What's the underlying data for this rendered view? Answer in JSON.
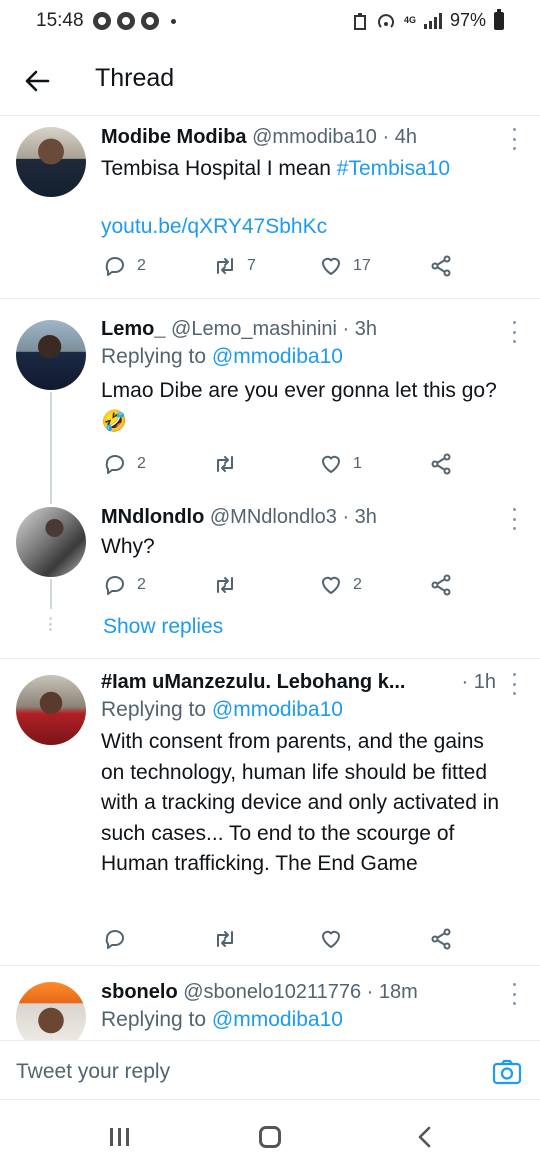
{
  "status_bar": {
    "time": "15:48",
    "network": "4G",
    "battery": "97%"
  },
  "header": {
    "title": "Thread"
  },
  "tweets": [
    {
      "name": "Modibe Modiba",
      "handle": "@mmodiba10",
      "time": "· 4h",
      "text_prefix": "Tembisa Hospital I mean ",
      "hashtag": "#Tembisa10",
      "link": "youtu.be/qXRY47SbhKc",
      "replies": "2",
      "retweets": "7",
      "likes": "17"
    },
    {
      "name": "Lemo_",
      "handle": "@Lemo_mashinini",
      "time": "· 3h",
      "replying_label": "Replying to ",
      "replying_to": "@mmodiba10",
      "text": "Lmao Dibe are you ever gonna let this go? 🤣",
      "replies": "2",
      "retweets": "",
      "likes": "1"
    },
    {
      "name": "MNdlondlo",
      "handle": "@MNdlondlo3",
      "time": "· 3h",
      "text": "Why?",
      "replies": "2",
      "retweets": "",
      "likes": "2",
      "show_replies": "Show replies"
    },
    {
      "name": "#Iam uManzezulu. Lebohang k...",
      "handle": "",
      "time": "· 1h",
      "replying_label": "Replying to ",
      "replying_to": "@mmodiba10",
      "text": "With consent from parents, and the gains on technology, human life should be fitted with a tracking device and only activated in such cases... To end to the scourge of Human trafficking. The End Game",
      "replies": "",
      "retweets": "",
      "likes": ""
    },
    {
      "name": "sbonelo",
      "handle": "@sbonelo10211776",
      "time": "· 18m",
      "replying_label": "Replying to ",
      "replying_to": "@mmodiba10"
    }
  ],
  "composer": {
    "placeholder": "Tweet your reply"
  },
  "colors": {
    "link": "#1d9bf0",
    "secondary_text": "#536471",
    "primary_text": "#0f1419"
  },
  "icons": [
    "arrow-left-icon",
    "reply-icon",
    "retweet-icon",
    "like-icon",
    "share-icon",
    "more-icon",
    "camera-icon"
  ]
}
